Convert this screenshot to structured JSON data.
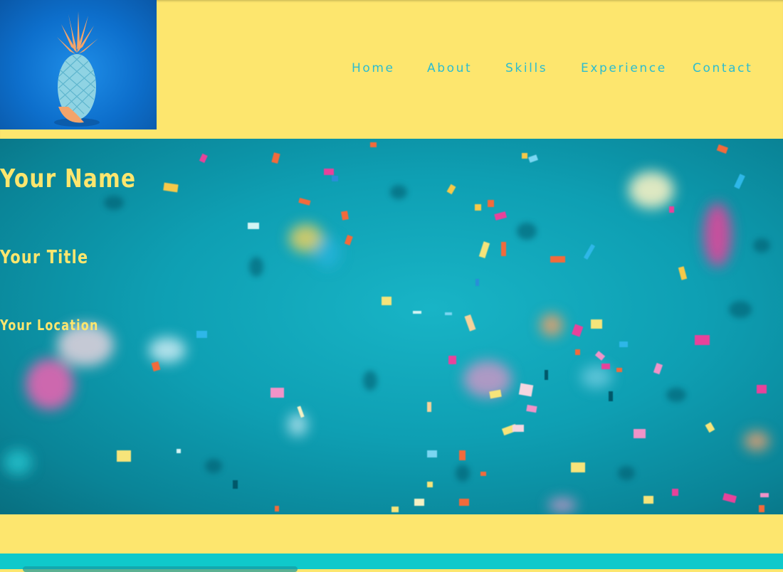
{
  "nav": {
    "home": "Home",
    "about": "About",
    "skills": "Skills",
    "experience": "Experience",
    "contact": "Contact"
  },
  "hero": {
    "name": "Your Name",
    "title": "Your Title",
    "location": "Your Location"
  },
  "colors": {
    "header_bg": "#fde66e",
    "nav_text": "#2bbcd0",
    "hero_text": "#fde66e",
    "hero_bg": "#0e9fb3",
    "footer_section": "#0fc9cb"
  },
  "images": {
    "logo": "pineapple-photo",
    "hero_background": "confetti-photo"
  }
}
